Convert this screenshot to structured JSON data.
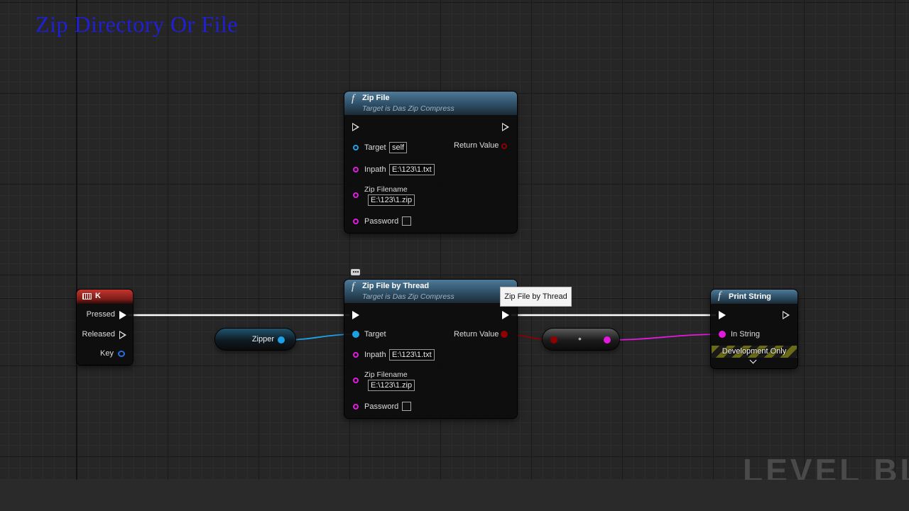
{
  "graph": {
    "title": "Zip Directory Or File",
    "watermark": "LEVEL BLU"
  },
  "colors": {
    "exec_wire": "#ffffff",
    "object_pin": "#1ea0e6",
    "string_pin": "#e21adf",
    "bool_pin": "#8f0000",
    "comment_title": "#1f1fd6"
  },
  "nodes": {
    "zip_file": {
      "icon": "function-icon",
      "title": "Zip File",
      "subtitle": "Target is Das Zip Compress",
      "target_label": "Target",
      "target_value": "self",
      "return_label": "Return Value",
      "inpath_label": "Inpath",
      "inpath_value": "E:\\123\\1.txt",
      "zipname_label": "Zip Filename",
      "zipname_value": "E:\\123\\1.zip",
      "password_label": "Password",
      "password_checked": false
    },
    "zip_file_thread": {
      "icon": "function-icon",
      "title": "Zip File by Thread",
      "subtitle": "Target is Das Zip Compress",
      "target_label": "Target",
      "return_label": "Return Value",
      "inpath_label": "Inpath",
      "inpath_value": "E:\\123\\1.txt",
      "zipname_label": "Zip Filename",
      "zipname_value": "E:\\123\\1.zip",
      "password_label": "Password",
      "password_checked": false,
      "comment_icon": "comment-bubble-icon"
    },
    "key_event": {
      "icon": "keyboard-icon",
      "title": "K",
      "pressed_label": "Pressed",
      "released_label": "Released",
      "key_label": "Key"
    },
    "zipper_var": {
      "label": "Zipper"
    },
    "conversion": {
      "dot": "•"
    },
    "print_string": {
      "icon": "function-icon",
      "title": "Print String",
      "in_string_label": "In String",
      "dev_only_label": "Development Only",
      "expand_icon": "chevron-down-icon"
    }
  },
  "tooltip": {
    "text": "Zip File by Thread"
  }
}
